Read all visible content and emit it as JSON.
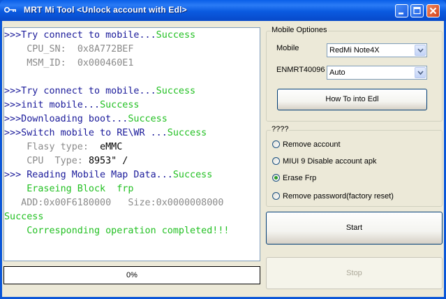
{
  "window": {
    "title": "MRT Mi Tool <Unlock account with Edl>"
  },
  "log": [
    [
      {
        "t": ">>>Try connect to mobile...",
        "c": "prompt"
      },
      {
        "t": "Success",
        "c": "ok"
      }
    ],
    [
      {
        "t": "    CPU_SN:  ",
        "c": "info"
      },
      {
        "t": "0x8A772BEF",
        "c": "info"
      }
    ],
    [
      {
        "t": "    MSM_ID:  ",
        "c": "info"
      },
      {
        "t": "0x000460E1",
        "c": "info"
      }
    ],
    [],
    [
      {
        "t": ">>>Try connect to mobile...",
        "c": "prompt"
      },
      {
        "t": "Success",
        "c": "ok"
      }
    ],
    [
      {
        "t": ">>>init mobile...",
        "c": "prompt"
      },
      {
        "t": "Success",
        "c": "ok"
      }
    ],
    [
      {
        "t": ">>>Downloading boot...",
        "c": "prompt"
      },
      {
        "t": "Success",
        "c": "ok"
      }
    ],
    [
      {
        "t": ">>>Switch mobile to RE\\WR ...",
        "c": "prompt"
      },
      {
        "t": "Success",
        "c": "ok"
      }
    ],
    [
      {
        "t": "    Flasy type:  ",
        "c": "info"
      },
      {
        "t": "eMMC",
        "c": "val"
      }
    ],
    [
      {
        "t": "    CPU  Type: ",
        "c": "info"
      },
      {
        "t": "8953\" /",
        "c": "val"
      }
    ],
    [
      {
        "t": ">>> Reading Mobile Map Data...",
        "c": "prompt"
      },
      {
        "t": "Success",
        "c": "ok"
      }
    ],
    [
      {
        "t": "    Eraseing Block  frp",
        "c": "ok"
      }
    ],
    [
      {
        "t": "   ADD:0x00F6180000   Size:0x0000008000",
        "c": "info"
      }
    ],
    [
      {
        "t": "Success",
        "c": "ok"
      }
    ],
    [
      {
        "t": "    Corresponding operation completed!!!",
        "c": "ok"
      }
    ]
  ],
  "progress": {
    "text": "0%",
    "value": 0
  },
  "mobile_options": {
    "legend": "Mobile Optiones",
    "mobile_label": "Mobile",
    "mobile_value": "RedMi Note4X",
    "enmrt_label": "ENMRT40096",
    "enmrt_value": "Auto",
    "edl_button": "How To into Edl"
  },
  "operations": {
    "legend": "????",
    "options": [
      {
        "label": "Remove account",
        "selected": false
      },
      {
        "label": "MIUI 9 Disable account apk",
        "selected": false
      },
      {
        "label": "Erase Frp",
        "selected": true
      },
      {
        "label": "Remove password(factory reset)",
        "selected": false
      }
    ]
  },
  "actions": {
    "start": "Start",
    "stop": "Stop"
  },
  "colors": {
    "prompt": "#1a1a9a",
    "ok": "#22c022",
    "info": "#8a8a8a",
    "titlebar": "#0a5ae0"
  }
}
